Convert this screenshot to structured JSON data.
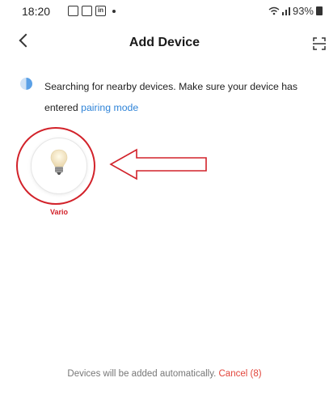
{
  "status_bar": {
    "time": "18:20",
    "battery": "93%",
    "app_icons": [
      "gallery-icon",
      "camera-icon",
      "linkedin-icon"
    ]
  },
  "header": {
    "title": "Add Device"
  },
  "search": {
    "text": "Searching for nearby devices. Make sure your device has entered ",
    "link": "pairing mode"
  },
  "devices": [
    {
      "name": "Vario",
      "icon": "bulb-icon"
    }
  ],
  "footer": {
    "text": "Devices will be added automatically. ",
    "cancel_label": "Cancel (8)"
  },
  "colors": {
    "accent_blue": "#2f84d8",
    "annotation_red": "#d2222a",
    "cancel_red": "#e2453b"
  }
}
